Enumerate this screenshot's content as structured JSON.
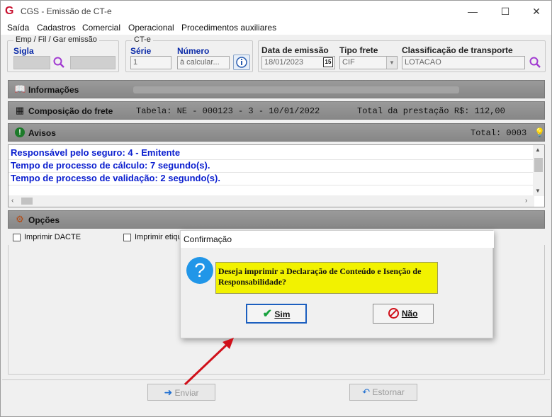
{
  "window": {
    "title": "CGS - Emissão de CT-e"
  },
  "menu": [
    "Saída",
    "Cadastros",
    "Comercial",
    "Operacional",
    "Procedimentos auxiliares"
  ],
  "emp_group": {
    "legend": "Emp / Fil / Gar emissão",
    "sigla_label": "Sigla"
  },
  "cte_group": {
    "legend": "CT-e",
    "serie_label": "Série",
    "serie_value": "1",
    "numero_label": "Número",
    "numero_value": "à calcular..."
  },
  "header_fields": {
    "data_emissao_label": "Data de emissão",
    "data_emissao_value": "18/01/2023",
    "tipo_frete_label": "Tipo frete",
    "tipo_frete_value": "CIF",
    "classificacao_label": "Classificação de transporte",
    "classificacao_value": "LOTACAO"
  },
  "sections": {
    "informacoes": {
      "title": "Informações"
    },
    "composicao": {
      "title": "Composição do frete",
      "tabela": "Tabela: NE - 000123 - 3 - 10/01/2022",
      "total": "Total da prestação R$: 112,00"
    },
    "avisos": {
      "title": "Avisos",
      "total": "Total: 0003",
      "lines": [
        "Responsável pelo seguro: 4 - Emitente",
        "Tempo de processo de cálculo: 7 segundo(s).",
        "Tempo de processo de validação: 2 segundo(s)."
      ]
    },
    "opcoes": {
      "title": "Opções",
      "check1": "Imprimir DACTE",
      "check2": "Imprimir etique"
    }
  },
  "buttons": {
    "enviar": "Enviar",
    "estornar": "Estornar"
  },
  "dialog": {
    "title": "Confirmação",
    "message": "Deseja imprimir a Declaração de Conteúdo e Isenção de Responsabilidade?",
    "yes": "Sim",
    "no": "Não"
  },
  "colors": {
    "accent_blue": "#0a1ecf",
    "message_bg": "#f2f200",
    "annotation_arrow": "#d0101a"
  },
  "icons": [
    "app-logo-icon",
    "minimize-icon",
    "maximize-icon",
    "close-icon",
    "search-icon",
    "info-icon",
    "calendar-icon",
    "dropdown-icon",
    "books-icon",
    "calculator-icon",
    "warning-icon",
    "lightbulb-icon",
    "options-icon",
    "question-icon",
    "check-icon",
    "cancel-icon",
    "arrow-right-icon",
    "undo-icon"
  ]
}
